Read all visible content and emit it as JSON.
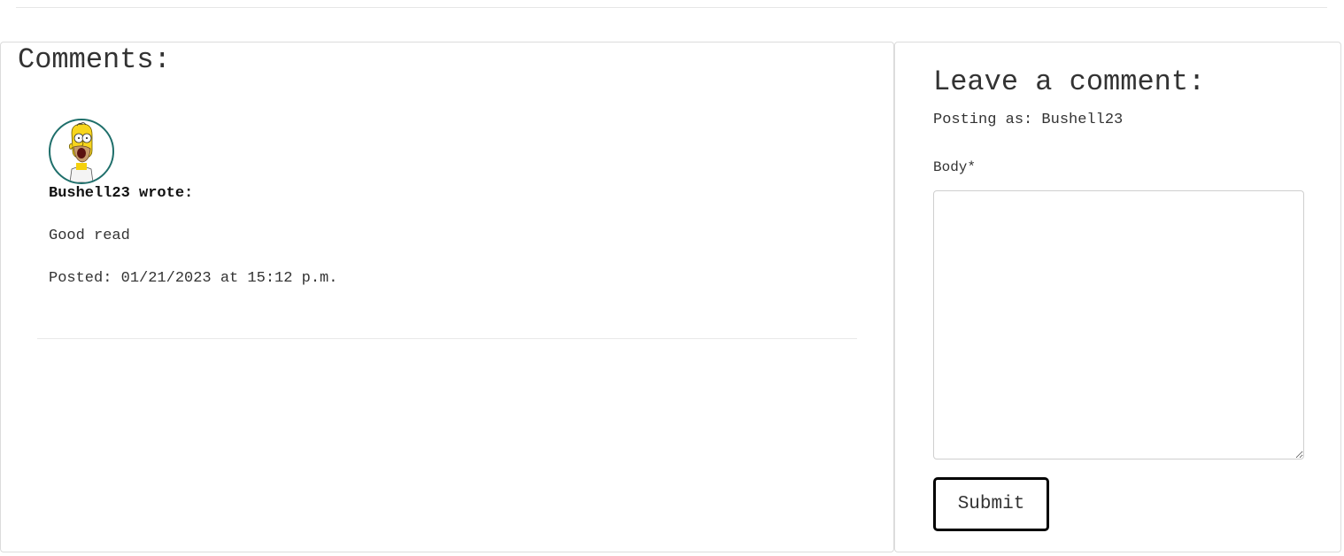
{
  "comments_section": {
    "title": "Comments:",
    "items": [
      {
        "author_line": "Bushell23 wrote:",
        "body": "Good read",
        "posted": "Posted: 01/21/2023 at 15:12 p.m."
      }
    ]
  },
  "comment_form": {
    "title": "Leave a comment:",
    "posting_as": "Posting as: Bushell23",
    "body_label": "Body*",
    "body_value": "",
    "submit_label": "Submit"
  },
  "colors": {
    "avatar_ring": "#1f6f6b",
    "button_border": "#000000",
    "card_border": "#dcdcdc"
  }
}
